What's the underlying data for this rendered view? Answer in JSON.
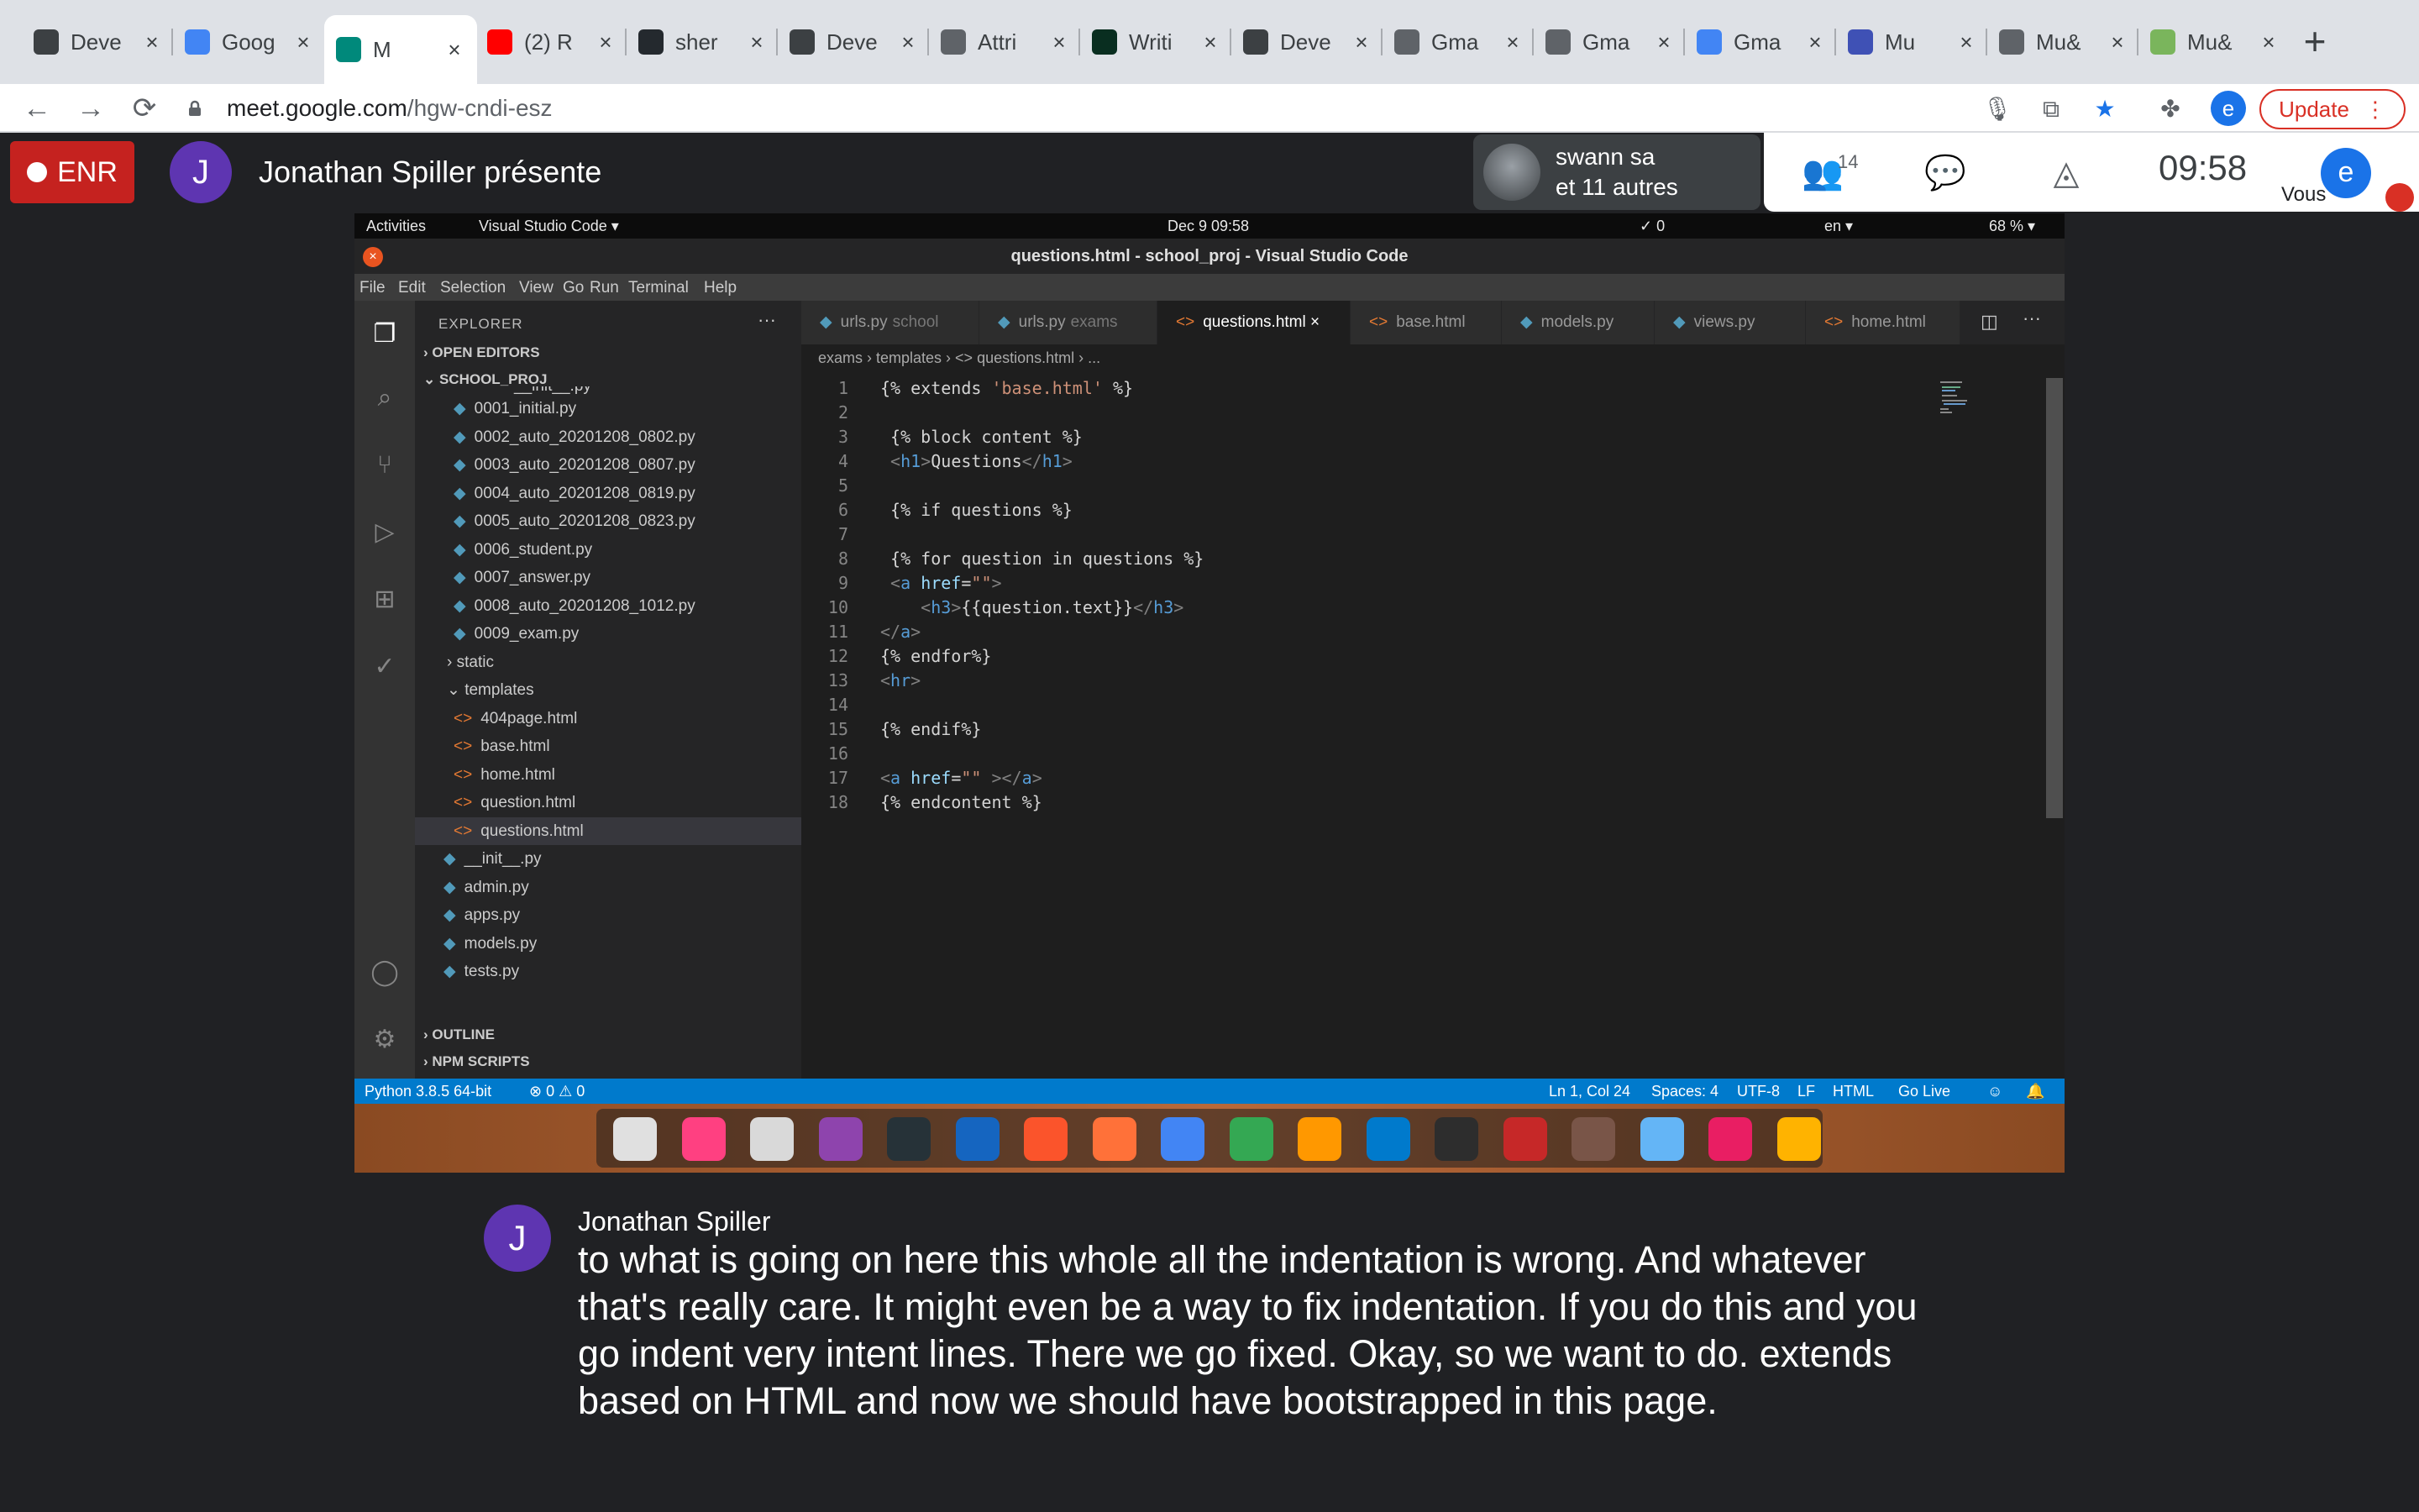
{
  "browser": {
    "tabs": [
      {
        "title": "Deve",
        "icon": "graduation-cap-icon",
        "color": "#3c4043"
      },
      {
        "title": "Goog",
        "icon": "google-translate-icon",
        "color": "#4285f4"
      },
      {
        "title": "M",
        "icon": "google-meet-icon",
        "color": "#00897b",
        "active": true
      },
      {
        "title": "(2) R",
        "icon": "youtube-icon",
        "color": "#ff0000"
      },
      {
        "title": "sher",
        "icon": "github-icon",
        "color": "#24292e"
      },
      {
        "title": "Deve",
        "icon": "graduation-cap-icon",
        "color": "#3c4043"
      },
      {
        "title": "Attri",
        "icon": "globe-icon",
        "color": "#5f6368"
      },
      {
        "title": "Writi",
        "icon": "django-icon",
        "color": "#092e20"
      },
      {
        "title": "Deve",
        "icon": "graduation-cap-icon",
        "color": "#3c4043"
      },
      {
        "title": "Gma",
        "icon": "globe-icon",
        "color": "#5f6368"
      },
      {
        "title": "Gma",
        "icon": "globe-icon",
        "color": "#5f6368"
      },
      {
        "title": "Gma",
        "icon": "google-icon",
        "color": "#4285f4"
      },
      {
        "title": "Mu",
        "icon": "bookmark-icon",
        "color": "#3f51b5"
      },
      {
        "title": "Mu&",
        "icon": "globe-icon",
        "color": "#5f6368"
      },
      {
        "title": "Mu&",
        "icon": "shopify-icon",
        "color": "#7ab55c"
      }
    ],
    "url_host": "meet.google.com",
    "url_path": "/hgw-cndi-esz",
    "profile_initial": "e",
    "update_label": "Update"
  },
  "meet": {
    "rec_label": "ENR",
    "presenter_initial": "J",
    "presenter_text": "Jonathan Spiller présente",
    "tile_line1": "swann sa",
    "tile_line2": "et 11 autres",
    "participants_count": "14",
    "clock": "09:58",
    "you_initial": "e",
    "you_label": "Vous"
  },
  "shared_screen": {
    "gnome": {
      "activities": "Activities",
      "app": "Visual Studio Code ▾",
      "datetime": "Dec 9  09:58",
      "count": "✓ 0",
      "lang": "en ▾",
      "battery": "68 % ▾"
    },
    "window_title": "questions.html - school_proj - Visual Studio Code",
    "menu": [
      "File",
      "Edit",
      "Selection",
      "View",
      "Go",
      "Run",
      "Terminal",
      "Help"
    ],
    "explorer": {
      "header": "EXPLORER",
      "open_editors": "OPEN EDITORS",
      "project": "SCHOOL_PROJ",
      "partial_top": "__init__.py",
      "migrations": [
        "0001_initial.py",
        "0002_auto_20201208_0802.py",
        "0003_auto_20201208_0807.py",
        "0004_auto_20201208_0819.py",
        "0005_auto_20201208_0823.py",
        "0006_student.py",
        "0007_answer.py",
        "0008_auto_20201208_1012.py",
        "0009_exam.py"
      ],
      "static": "static",
      "templates": "templates",
      "template_files": [
        "404page.html",
        "base.html",
        "home.html",
        "question.html",
        "questions.html"
      ],
      "app_files": [
        "__init__.py",
        "admin.py",
        "apps.py",
        "models.py",
        "tests.py"
      ],
      "outline": "OUTLINE",
      "npm": "NPM SCRIPTS"
    },
    "editor_tabs": [
      {
        "name": "urls.py",
        "sub": "school",
        "kind": "py"
      },
      {
        "name": "urls.py",
        "sub": "exams",
        "kind": "py"
      },
      {
        "name": "questions.html",
        "sub": "",
        "kind": "html",
        "active": true
      },
      {
        "name": "base.html",
        "sub": "",
        "kind": "html"
      },
      {
        "name": "models.py",
        "sub": "",
        "kind": "py"
      },
      {
        "name": "views.py",
        "sub": "",
        "kind": "py"
      },
      {
        "name": "home.html",
        "sub": "",
        "kind": "html"
      }
    ],
    "breadcrumbs": "exams  ›  templates  ›  <> questions.html  ›  ...",
    "code_lines": [
      "{% extends 'base.html' %}",
      "",
      " {% block content %}",
      " <h1>Questions</h1>",
      "",
      " {% if questions %}",
      "",
      " {% for question in questions %}",
      " <a href=\"\">",
      "    <h3>{{question.text}}</h3>",
      "</a>",
      "{% endfor%}",
      "<hr>",
      "",
      "{% endif%}",
      "",
      "<a href=\"\" ></a>",
      "{% endcontent %}"
    ],
    "status": {
      "python": "Python 3.8.5 64-bit",
      "problems": "⊗ 0 ⚠ 0",
      "position": "Ln 1, Col 24",
      "spaces": "Spaces: 4",
      "encoding": "UTF-8",
      "eol": "LF",
      "language": "HTML",
      "golive": "Go Live"
    },
    "dock_colors": [
      "#e0e0e0",
      "#ff4081",
      "#d9d9d9",
      "#8e44ad",
      "#263238",
      "#1565c0",
      "#fb542b",
      "#ff7139",
      "#4285f4",
      "#34a853",
      "#ff9800",
      "#007acc",
      "#2d2d2d",
      "#c62828",
      "#795548",
      "#64b5f6",
      "#e91e63",
      "#ffb300"
    ]
  },
  "captions": {
    "speaker_initial": "J",
    "speaker": "Jonathan Spiller",
    "text": "to what is going on here this whole all the indentation is wrong. And whatever that's really care. It might even be a way to fix indentation. If you do this and you go indent very intent lines. There we go fixed. Okay, so we want to do. extends based on HTML and now we should have bootstrapped in this page."
  }
}
